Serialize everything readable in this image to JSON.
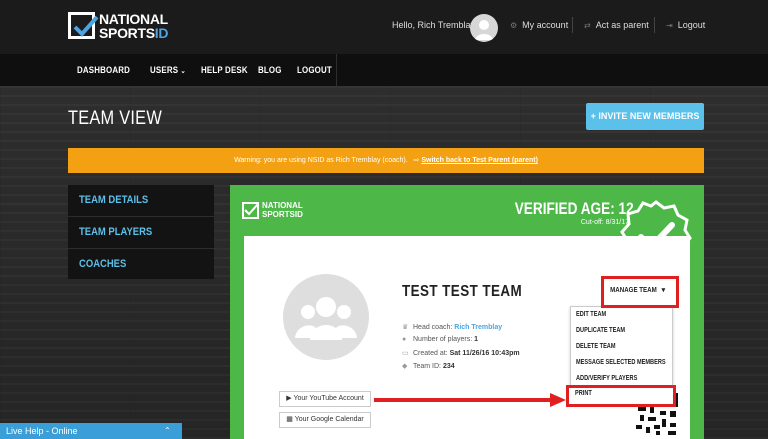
{
  "header": {
    "logo_line1": "NATIONAL",
    "logo_line2": "SPORTS",
    "logo_line2_accent": "ID",
    "greeting": "Hello, Rich Tremblay",
    "my_account": "My account",
    "act_as_parent": "Act as parent",
    "logout": "Logout"
  },
  "nav": {
    "items": [
      "DASHBOARD",
      "USERS",
      "HELP DESK",
      "BLOG",
      "LOGOUT"
    ]
  },
  "page": {
    "title": "TEAM VIEW",
    "invite_button": "+ INVITE NEW MEMBERS"
  },
  "warning": {
    "text": "Warning: you are using NSID as Rich Tremblay (coach).",
    "link": "Switch back to Test Parent (parent)"
  },
  "sidebar": {
    "items": [
      "TEAM DETAILS",
      "TEAM PLAYERS",
      "COACHES"
    ]
  },
  "team_card": {
    "logo_line1": "NATIONAL",
    "logo_line2": "SPORTSID",
    "verified_age": "VERIFIED AGE: 12",
    "cutoff": "Cut-off: 8/31/17",
    "team_name": "TEST TEST TEAM",
    "head_coach_label": "Head coach:",
    "head_coach": "Rich Tremblay",
    "players_label": "Number of players:",
    "players": "1",
    "created_label": "Created at:",
    "created": "Sat 11/26/16 10:43pm",
    "team_id_label": "Team ID:",
    "team_id": "234",
    "youtube_button": "Your YouTube Account",
    "calendar_button": "Your Google Calendar"
  },
  "manage_menu": {
    "label": "MANAGE TEAM",
    "items": [
      "EDIT TEAM",
      "DUPLICATE TEAM",
      "DELETE TEAM",
      "MESSAGE SELECTED MEMBERS",
      "ADD/VERIFY PLAYERS",
      "PRINT"
    ]
  },
  "live_help": {
    "label": "Live Help - Online"
  },
  "colors": {
    "accent_blue": "#5bc0ea",
    "warning_orange": "#f3a112",
    "card_green": "#4db848",
    "highlight_red": "#e02020"
  }
}
